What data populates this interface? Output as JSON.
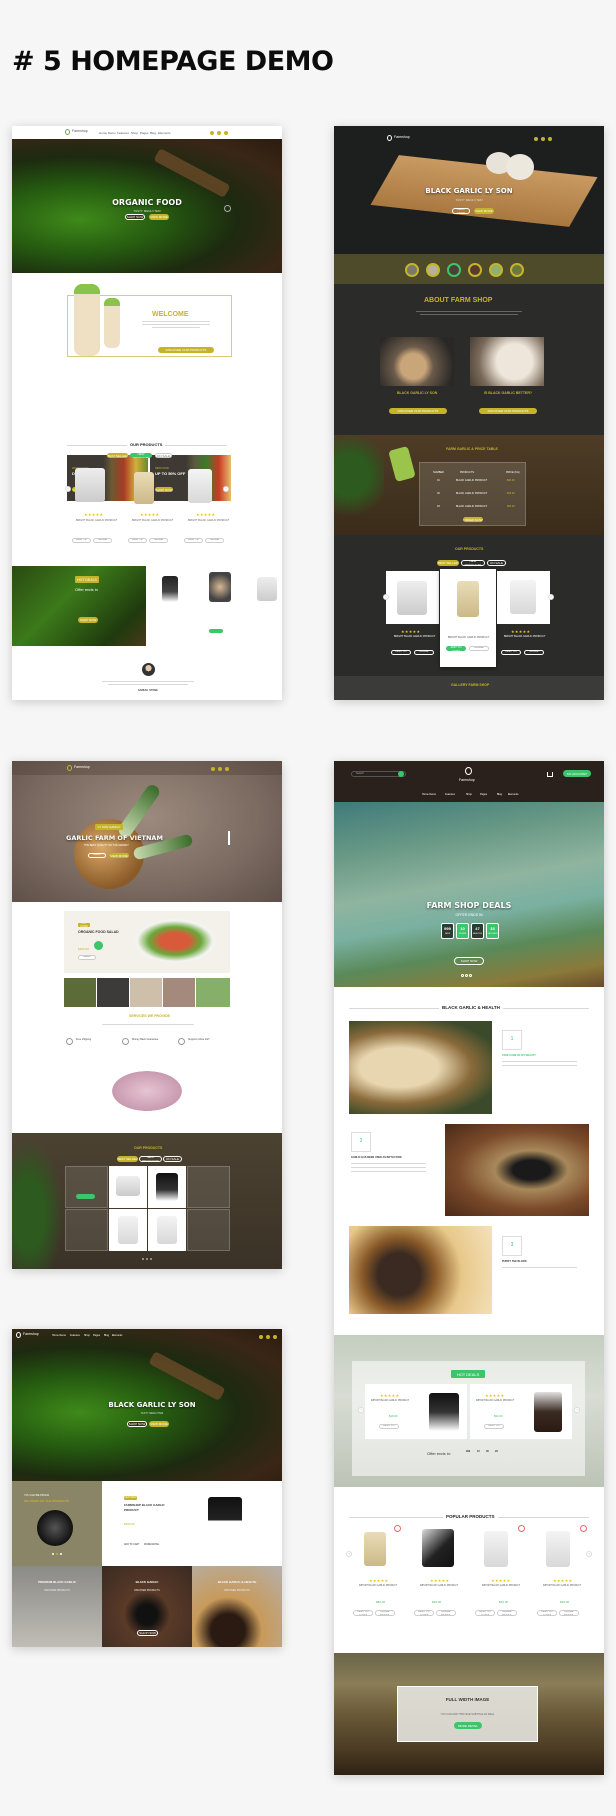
{
  "page_heading": "# 5 HOMEPAGE DEMO",
  "colors": {
    "olive_accent": "#c5b42a",
    "green_accent": "#3dc56a",
    "dark_bg": "#2b2c2a",
    "brown_header": "#2a211c",
    "olive_band": "#4e4b2b"
  },
  "demo1": {
    "logo": "Farmshop",
    "nav": [
      "Home Demo",
      "Features",
      "Shop",
      "Pages",
      "Blog",
      "Elements"
    ],
    "hero_title": "ORGANIC FOOD",
    "hero_subtitle": "TASTY MENU ITEM",
    "hero_buttons": [
      "SHOP NOW",
      "VIEW MORE"
    ],
    "welcome_title": "WELCOME",
    "welcome_button": "DISCOVER OUR PRODUCTS",
    "banners": [
      {
        "tag": "FRESH FOOD",
        "title": "DISCOUNT 25%",
        "button": "SHOP NOW"
      },
      {
        "tag": "NEW FOOD",
        "title": "UP TO 50% OFF",
        "button": "SHOP NOW"
      }
    ],
    "products_title": "OUR PRODUCTS",
    "product_tabs": [
      "BEST SELLER",
      "NEW PRODUCTS",
      "ON SALE"
    ],
    "products": [
      {
        "name": "BRIGHT BLACK GARLIC PRODUCT",
        "buttons": [
          "ADD TO CART",
          "MORE DETAIL"
        ]
      },
      {
        "name": "BRIGHT BLACK GARLIC PRODUCT",
        "buttons": [
          "ADD TO CART",
          "MORE DETAIL"
        ]
      },
      {
        "name": "BRIGHT BLACK GARLIC PRODUCT",
        "buttons": [
          "ADD TO CART",
          "MORE DETAIL"
        ]
      }
    ],
    "hot_deals_label": "HOT DEALS",
    "offer_ends": "Offer ends in",
    "hot_deal_button": "SHOP NOW",
    "testimonial_name": "SAMUEL STONE"
  },
  "demo2": {
    "logo": "Farmshop",
    "hero_title": "BLACK GARLIC LY SON",
    "hero_subtitle": "TASTY MENU ITEM",
    "hero_buttons": [
      "SHOP NOW",
      "VIEW MORE"
    ],
    "about_title": "ABOUT FARM SHOP",
    "about_items": [
      {
        "title": "BLACK GARLIC LY SON",
        "button": "DISCOVER OUR PRODUCTS"
      },
      {
        "title": "IS BLACK GARLIC BETTER?",
        "button": "DISCOVER OUR PRODUCTS"
      }
    ],
    "price_table_title": "FARM GARLIC & PRICE TABLE",
    "price_table_headers": [
      "NUMBER",
      "PRODUCTS",
      "PRICE (KG)"
    ],
    "price_table_rows": [
      {
        "number": "01",
        "product": "BLACK GARLIC PRODUCT",
        "price": "$40.00"
      },
      {
        "number": "02",
        "product": "BLACK GARLIC PRODUCT",
        "price": "$45.00"
      },
      {
        "number": "03",
        "product": "BLACK GARLIC PRODUCT",
        "price": "$50.00"
      }
    ],
    "price_table_button": "ORDER NOW",
    "products_title": "OUR PRODUCTS",
    "product_tabs": [
      "BEST SELLER",
      "NEW PRODUCTS",
      "ON SALE"
    ],
    "products": [
      {
        "name": "BRIGHT BLACK GARLIC PRODUCT"
      },
      {
        "name": "BRIGHT BLACK GARLIC PRODUCT"
      },
      {
        "name": "BRIGHT BLACK GARLIC PRODUCT"
      }
    ],
    "product_buttons": [
      "ADD TO CART",
      "MORE DETAIL"
    ],
    "gallery_title": "GALLERY FARM SHOP"
  },
  "demo3": {
    "logo": "Farmshop",
    "hero_tag": "LY SON GARLIC",
    "hero_title": "GARLIC FARM OF VIETNAM",
    "hero_subtitle": "THE BEST QUALITY ON THE MARKET",
    "hero_buttons": [
      "SHOP NOW",
      "VIEW MORE"
    ],
    "feature_tag": "HOT FOOD",
    "feature_title": "ORGANIC FOOD SALAD",
    "feature_price": "$400.00",
    "feature_badge": "SALE",
    "feature_button": "SHOP NOW",
    "services_title": "SERVICES WE PROVIDE",
    "services": [
      "Free shipping",
      "Money Back Guarantee",
      "Support online 24/7"
    ],
    "products_title": "OUR PRODUCTS",
    "product_tabs": [
      "BEST SELLER",
      "NEW PRODUCTS",
      "ON SALE"
    ]
  },
  "demo4": {
    "search_placeholder": "Search",
    "logo": "Farmshop",
    "account_button": "MY ACCOUNT",
    "nav": [
      "Home Demo",
      "Features",
      "Shop",
      "Pages",
      "Blog",
      "Elements"
    ],
    "hero_title": "FARM SHOP DEALS",
    "hero_subtitle": "OFFER ENDS IN",
    "countdown": [
      {
        "value": "999",
        "unit": "DAYS"
      },
      {
        "value": "10",
        "unit": "HOURS"
      },
      {
        "value": "47",
        "unit": "MINUTES"
      },
      {
        "value": "33",
        "unit": "SECONDS"
      }
    ],
    "hero_button": "SHOP NOW",
    "health_title": "BLACK GARLIC & HEALTH",
    "health_items": [
      {
        "number": "1",
        "title": "TAKE CARE OF MY BEAUTY"
      },
      {
        "number": "2",
        "title": "GARLIC HAS BEEN USED AS BOTH FOOD"
      },
      {
        "number": "3",
        "title": "PURIFY THE BLOOD"
      }
    ],
    "hot_deals_label": "HOT DEALS",
    "hot_deals": [
      {
        "name": "IMPORT BLACK GARLIC PRODUCT",
        "price": "$18.00",
        "button": "ADD TO CART"
      },
      {
        "name": "IMPORT BLACK GARLIC PRODUCT",
        "price": "$90.00",
        "button": "ADD TO CART"
      }
    ],
    "offer_ends": "Offer ends in:",
    "offer_countdown": [
      {
        "value": "999",
        "unit": "Days"
      },
      {
        "value": "10",
        "unit": "Hours"
      },
      {
        "value": "46",
        "unit": "Minutes"
      },
      {
        "value": "29",
        "unit": "Seconds"
      }
    ],
    "popular_title": "POPULAR PRODUCTS",
    "popular_products": [
      {
        "name": "IMPORT BLACK GARLIC PRODUCT",
        "price": "$80.00"
      },
      {
        "name": "IMPORT BLACK GARLIC PRODUCT",
        "price": "$49.00"
      },
      {
        "name": "IMPORT BLACK GARLIC PRODUCT",
        "price": "$30.00"
      },
      {
        "name": "IMPORT BLACK GARLIC PRODUCT",
        "price": "$49.00"
      }
    ],
    "popular_buttons": [
      "ADD TO CART",
      "MORE DETAIL"
    ],
    "full_width_title": "FULL WIDTH IMAGE",
    "full_width_subtitle": "YOU CAN ADD THIS NICE SUBTITLE AS WELL",
    "full_width_button": "MORE DETAIL"
  },
  "demo5": {
    "logo": "Farmshop",
    "nav": [
      "Home Demo",
      "Features",
      "Shop",
      "Pages",
      "Blog",
      "Elements"
    ],
    "hero_title": "BLACK GARLIC LY SON",
    "hero_subtitle": "TASTY MENU ITEM",
    "hero_buttons": [
      "SHOP NOW",
      "VIEW MORE"
    ],
    "promo_tag": "YOU CAN BE PROUD",
    "promo_title": "WE PRODUCE THE PRODUCTS",
    "product_tag": "FEATURED",
    "product_title": "FARMSHOP BLACK GARLIC PRODUCT",
    "product_price": "$450.00",
    "product_links": [
      "ADD TO CART",
      "MORE DETAIL"
    ],
    "categories": [
      {
        "title": "PREMIUM BLACK GARLIC",
        "subtitle": "DISCOVER PRODUCTS"
      },
      {
        "title": "BLACK GARLIC",
        "subtitle": "DISCOVER PRODUCTS",
        "button": "SHOP NOW"
      },
      {
        "title": "BLACK GARLIC & HEALTH",
        "subtitle": "DISCOVER PRODUCTS"
      }
    ]
  }
}
